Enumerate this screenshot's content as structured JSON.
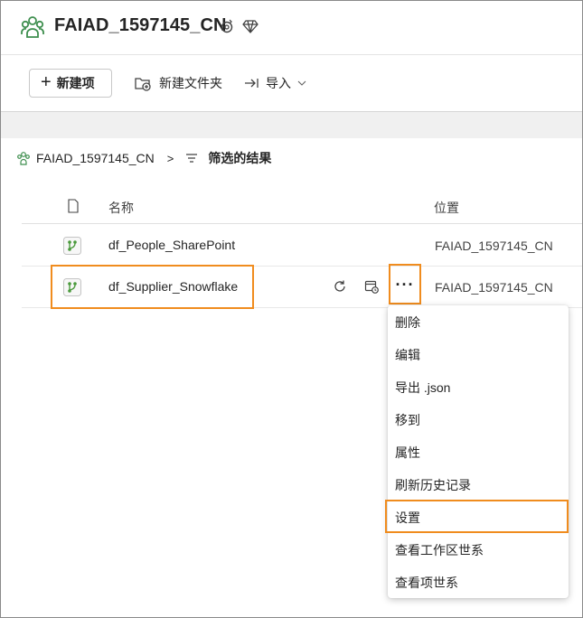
{
  "workspace": {
    "title": "FAIAD_1597145_CN",
    "icons": [
      "workspace-people-icon",
      "settings-badge-icon",
      "diamond-icon"
    ]
  },
  "toolbar": {
    "new_item": "新建项",
    "new_folder": "新建文件夹",
    "import": "导入"
  },
  "breadcrumb": {
    "root": "FAIAD_1597145_CN",
    "separator": ">",
    "current": "筛选的结果"
  },
  "table": {
    "headers": {
      "name": "名称",
      "location": "位置"
    },
    "rows": [
      {
        "name": "df_People_SharePoint",
        "location": "FAIAD_1597145_CN",
        "icon": "dataflow-icon"
      },
      {
        "name": "df_Supplier_Snowflake",
        "location": "FAIAD_1597145_CN",
        "icon": "dataflow-icon"
      }
    ],
    "more": "···"
  },
  "context_menu": {
    "items": [
      "删除",
      "编辑",
      "导出 .json",
      "移到",
      "属性",
      "刷新历史记录",
      "设置",
      "查看工作区世系",
      "查看项世系"
    ],
    "highlighted": "设置"
  },
  "colors": {
    "highlight": "#f08c1e",
    "dataflow_green": "#4a9a3c",
    "brand_green": "#3f8f4f"
  }
}
